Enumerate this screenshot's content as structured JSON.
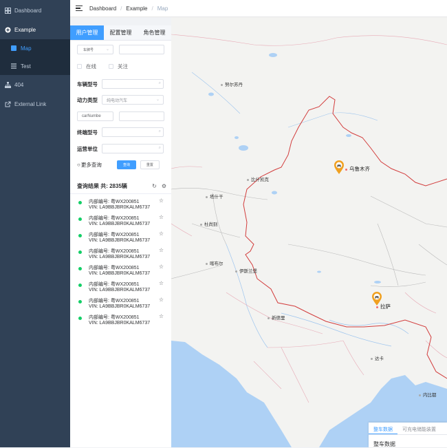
{
  "sidebar": {
    "items": [
      {
        "label": "Dashboard",
        "icon": "dashboard-icon"
      },
      {
        "label": "Example",
        "icon": "example-plus-icon"
      },
      {
        "label": "Map",
        "icon": "map-icon"
      },
      {
        "label": "Test",
        "icon": "test-icon"
      },
      {
        "label": "404",
        "icon": "tree-icon"
      },
      {
        "label": "External Link",
        "icon": "external-link-icon"
      }
    ]
  },
  "breadcrumb": {
    "items": [
      "Dashboard",
      "Example",
      "Map"
    ],
    "separator": "/"
  },
  "panel": {
    "tabs": [
      "用户管理",
      "配置管理",
      "角色管理"
    ],
    "filter1": {
      "select": "车牌号",
      "value": ""
    },
    "checks": [
      "在线",
      "关注"
    ],
    "fields": {
      "vehicle_model": {
        "label": "车辆型号",
        "value": ""
      },
      "power_type": {
        "label": "动力类型",
        "value": "纯电动汽车"
      },
      "car_number": {
        "select": "carNumbe",
        "value": ""
      },
      "terminal_model": {
        "label": "终端型号",
        "value": ""
      },
      "operator": {
        "label": "运营单位",
        "value": ""
      }
    },
    "more_query": "更多查询",
    "query_button": "查询",
    "reset_button": "重置",
    "result_title": "查询结果 共: 2835辆",
    "vehicles": [
      {
        "line1": "内部编号: 粤WX200851",
        "line2": "VIN: LA9BBJBR0KALM6737"
      },
      {
        "line1": "内部编号: 粤WX200851",
        "line2": "VIN: LA9BBJBR0KALM6737"
      },
      {
        "line1": "内部编号: 粤WX200851",
        "line2": "VIN: LA9BBJBR0KALM6737"
      },
      {
        "line1": "内部编号: 粤WX200851",
        "line2": "VIN: LA9BBJBR0KALM6737"
      },
      {
        "line1": "内部编号: 粤WX200851",
        "line2": "VIN: LA9BBJBR0KALM6737"
      },
      {
        "line1": "内部编号: 粤WX200851",
        "line2": "VIN: LA9BBJBR0KALM6737"
      },
      {
        "line1": "内部编号: 粤WX200851",
        "line2": "VIN: LA9BBJBR0KALM6737"
      },
      {
        "line1": "内部编号: 粤WX200851",
        "line2": "VIN: LA9BBJBR0KALM6737"
      }
    ]
  },
  "map": {
    "labels": {
      "aksu": "努尔苏丹",
      "urumqi": "乌鲁木齐",
      "bishkek": "比什凯克",
      "tashkent": "塔什干",
      "dushanbe": "杜尚别",
      "kabul": "喀布尔",
      "islamabad": "伊斯兰堡",
      "newdelhi": "新德里",
      "lhasa": "拉萨",
      "dhaka": "达卡",
      "naypyidaw": "内比都"
    },
    "accent": "#f0a020",
    "border_color": "#d23c3c"
  },
  "datacard": {
    "tabs": [
      "整车数据",
      "可充电储能装置"
    ],
    "title": "整车数据"
  },
  "colors": {
    "sidebar": "#304156",
    "active": "#409eff",
    "online": "#13ce66"
  }
}
